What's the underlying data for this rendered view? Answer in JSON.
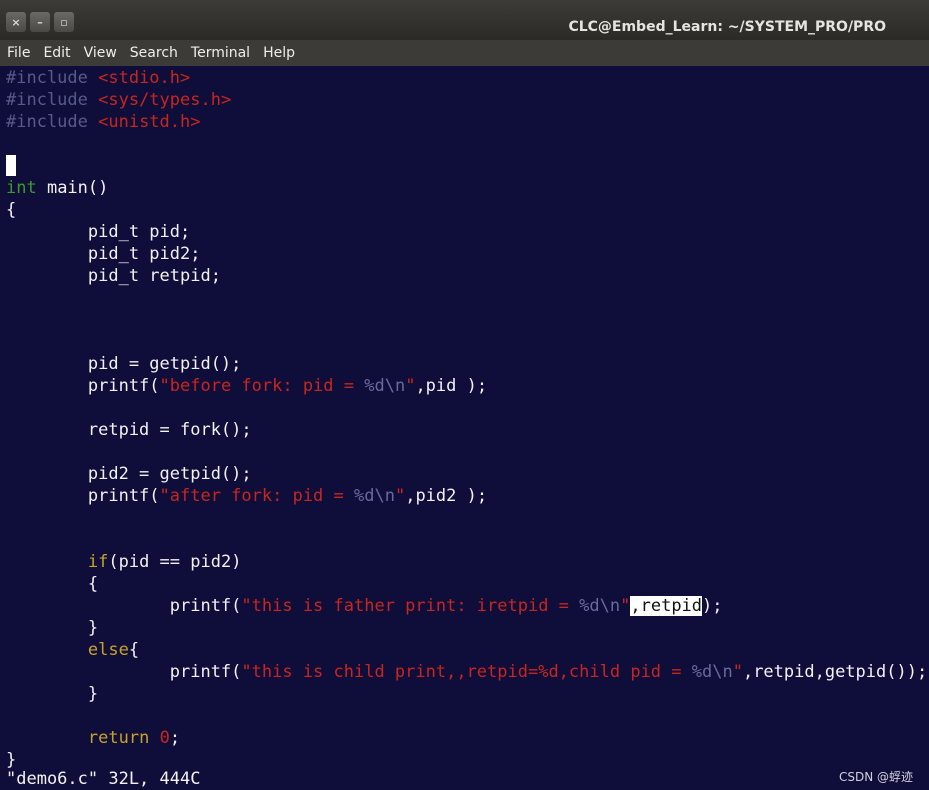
{
  "window": {
    "title": "CLC@Embed_Learn: ~/SYSTEM_PRO/PRO",
    "close_glyph": "×",
    "minimize_glyph": "–",
    "maximize_glyph": "▫"
  },
  "menu": [
    "File",
    "Edit",
    "View",
    "Search",
    "Terminal",
    "Help"
  ],
  "code": {
    "l1": {
      "pp": "#include ",
      "hdr": "<stdio.h>"
    },
    "l2": {
      "pp": "#include ",
      "hdr": "<sys/types.h>"
    },
    "l3": {
      "pp": "#include ",
      "hdr": "<unistd.h>"
    },
    "l5": {
      "kw": "int",
      "rest": " main()"
    },
    "l6": "{",
    "l7": "        pid_t pid;",
    "l8": "        pid_t pid2;",
    "l9": "        pid_t retpid;",
    "l13": "        pid = getpid();",
    "l14": {
      "a": "        printf(",
      "s": "\"before fork: pid = ",
      "e": "%d\\n",
      "s2": "\"",
      "b": ",pid );"
    },
    "l16": "        retpid = fork();",
    "l18": "        pid2 = getpid();",
    "l19": {
      "a": "        printf(",
      "s": "\"after fork: pid = ",
      "e": "%d\\n",
      "s2": "\"",
      "b": ",pid2 );"
    },
    "l22": {
      "indent": "        ",
      "kw": "if",
      "rest": "(pid == pid2)"
    },
    "l23": "        {",
    "l24": {
      "a": "                printf(",
      "s": "\"this is father print: iretpid = ",
      "e": "%d\\n",
      "s2": "\"",
      "sel": ",retpid",
      "b": ");"
    },
    "l25": "        }",
    "l26": {
      "indent": "        ",
      "kw": "else",
      "rest": "{"
    },
    "l27": {
      "a": "                printf(",
      "s": "\"this is child print,,retpid=%d,child pid = ",
      "e": "%d\\n",
      "s2": "\"",
      "b": ",retpid,getpid());"
    },
    "l28": "        }",
    "l30": {
      "indent": "        ",
      "kw": "return",
      "sp": " ",
      "num": "0",
      "b": ";"
    },
    "l31": "}"
  },
  "status_line": "\"demo6.c\" 32L, 444C",
  "watermark": "CSDN @蜉迹"
}
